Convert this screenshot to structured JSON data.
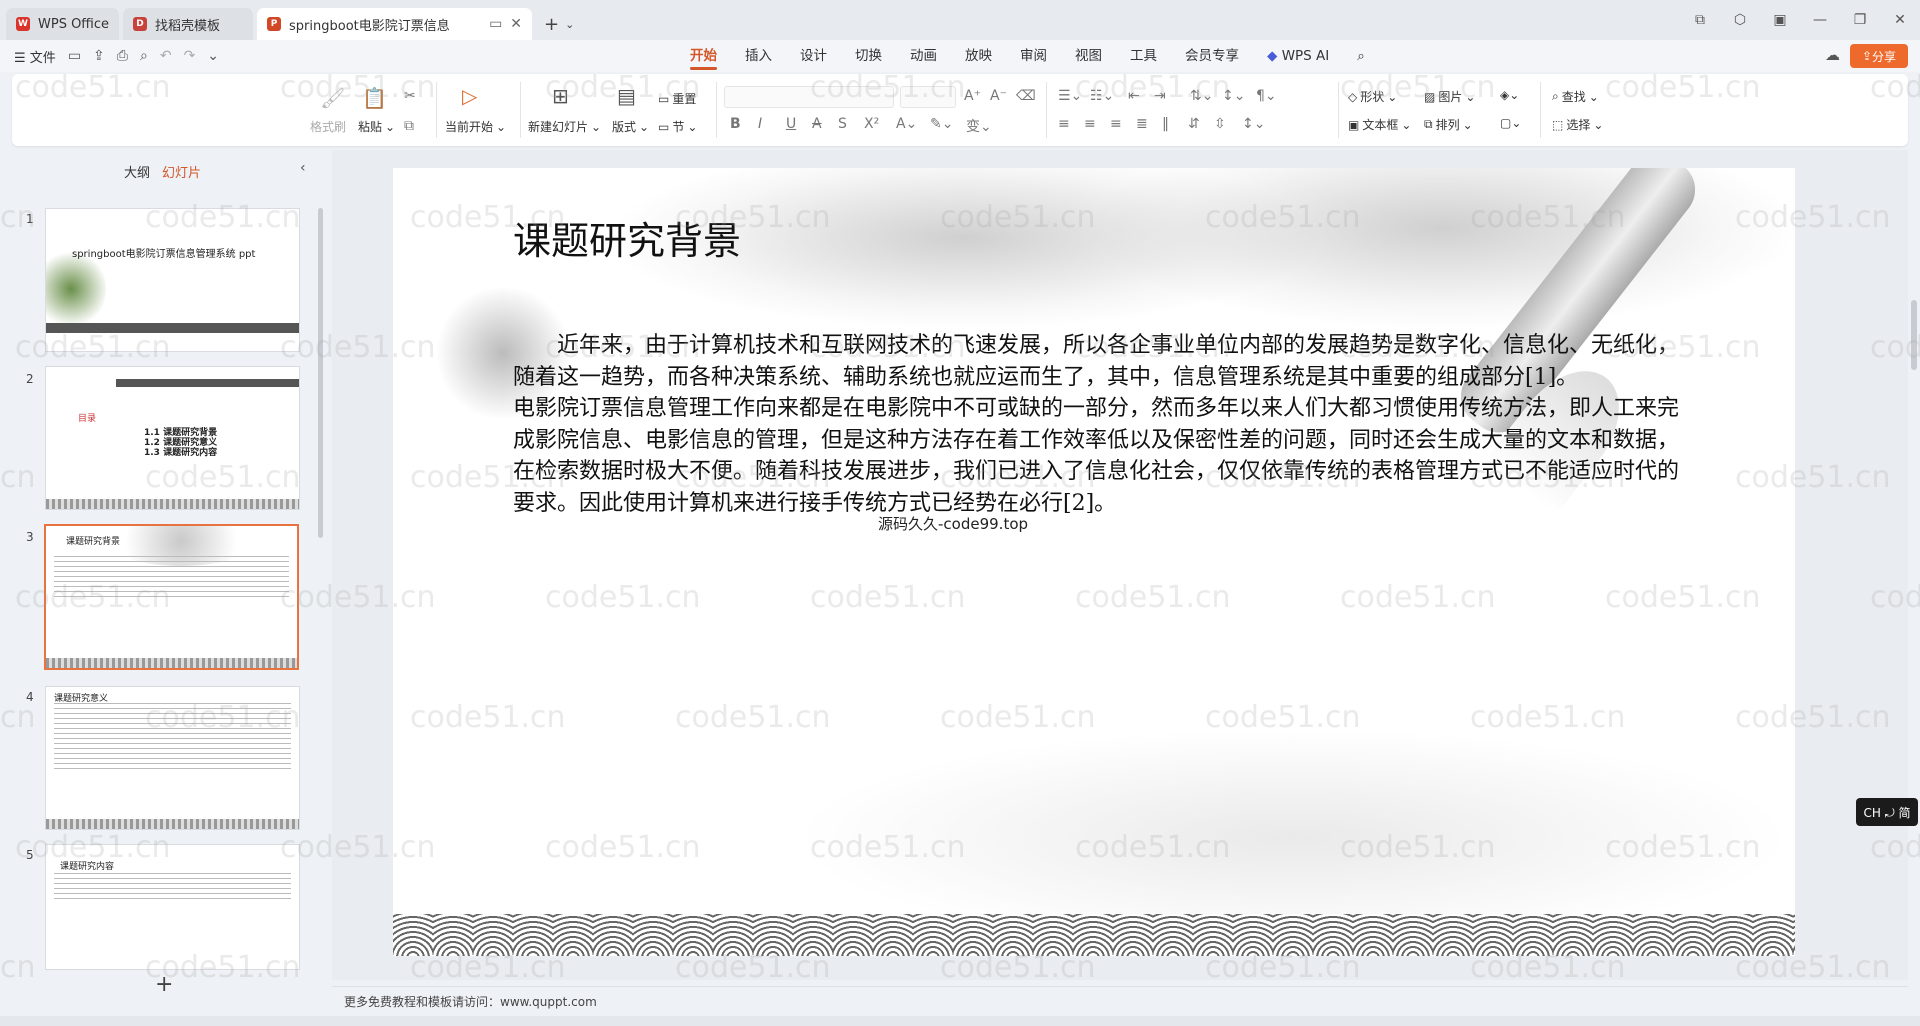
{
  "tabs": [
    {
      "label": "WPS Office",
      "icon": "wps-logo",
      "color": "#d9342b"
    },
    {
      "label": "找稻壳模板",
      "icon": "daoke-logo",
      "color": "#c7423a"
    },
    {
      "label": "springboot电影院订票信息",
      "icon": "ppt-logo",
      "color": "#d24726"
    }
  ],
  "menubar": {
    "file": "文件",
    "ribbon_tabs": [
      "开始",
      "插入",
      "设计",
      "切换",
      "动画",
      "放映",
      "审阅",
      "视图",
      "工具",
      "会员专享"
    ],
    "wps_ai": "WPS AI",
    "share": "分享"
  },
  "ribbon": {
    "format_painter": "格式刷",
    "paste": "粘贴",
    "play_current": "当前开始",
    "new_slide": "新建幻灯片",
    "layout": "版式",
    "section": "节",
    "reset": "重置",
    "shape": "形状",
    "picture": "图片",
    "textbox": "文本框",
    "arrange": "排列",
    "find": "查找",
    "select": "选择"
  },
  "left_panel": {
    "outline_tab": "大纲",
    "slides_tab": "幻灯片",
    "thumbnails": [
      {
        "num": "1",
        "title": "springboot电影院订票信息管理系统 ppt"
      },
      {
        "num": "2",
        "items": [
          "1.1 课题研究背景",
          "1.2 课题研究意义",
          "1.3 课题研究内容"
        ],
        "tag": "目录"
      },
      {
        "num": "3",
        "title": "课题研究背景"
      },
      {
        "num": "4",
        "title": "课题研究意义"
      },
      {
        "num": "5",
        "title": "课题研究内容"
      }
    ]
  },
  "slide": {
    "title": "课题研究背景",
    "para1": "近年来，由于计算机技术和互联网技术的飞速发展，所以各企事业单位内部的发展趋势是数字化、信息化、无纸化，随着这一趋势，而各种决策系统、辅助系统也就应运而生了，其中，信息管理系统是其中重要的组成部分[1]。",
    "para2": "电影院订票信息管理工作向来都是在电影院中不可或缺的一部分，然而多年以来人们大都习惯使用传统方法，即人工来完成影院信息、电影信息的管理，但是这种方法存在着工作效率低以及保密性差的问题，同时还会生成大量的文本和数据，在检索数据时极大不便。随着科技发展进步，我们已进入了信息化社会，仅仅依靠传统的表格管理方式已不能适应时代的要求。因此使用计算机来进行接手传统方式已经势在必行[2]。",
    "overlay": "源码久久-code99.top"
  },
  "notes": "更多免费教程和模板请访问：www.quppt.com",
  "ime": "CH ⤾ 简",
  "watermark": "code51.cn"
}
